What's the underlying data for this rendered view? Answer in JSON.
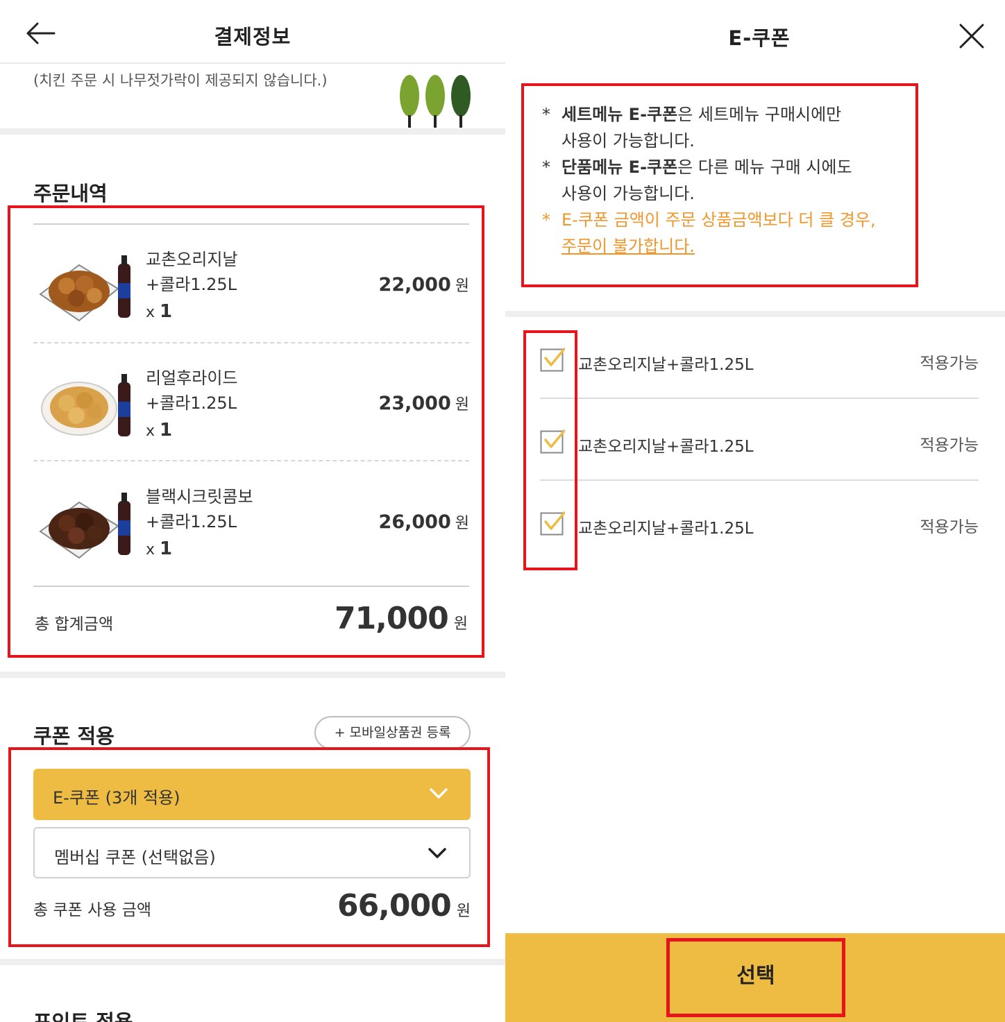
{
  "left_panel": {
    "header_title": "결제정보",
    "notice": "(치킨 주문 시 나무젓가락이 제공되지 않습니다.)",
    "order_section_title": "주문내역",
    "orders": [
      {
        "name_line1": "교촌오리지날",
        "name_line2": "+콜라1.25L",
        "qty_prefix": "x",
        "qty": "1",
        "price": "22,000",
        "currency": "원"
      },
      {
        "name_line1": "리얼후라이드",
        "name_line2": "+콜라1.25L",
        "qty_prefix": "x",
        "qty": "1",
        "price": "23,000",
        "currency": "원"
      },
      {
        "name_line1": "블랙시크릿콤보",
        "name_line2": "+콜라1.25L",
        "qty_prefix": "x",
        "qty": "1",
        "price": "26,000",
        "currency": "원"
      }
    ],
    "order_total_label": "총 합계금액",
    "order_total_amount": "71,000",
    "order_total_currency": "원",
    "coupon_section_title": "쿠폰 적용",
    "mobile_voucher_button": "+ 모바일상품권 등록",
    "ecoupon_select": "E-쿠폰 (3개 적용)",
    "membership_select": "멤버십 쿠폰 (선택없음)",
    "coupon_total_label": "총 쿠폰 사용 금액",
    "coupon_total_amount": "66,000",
    "coupon_total_currency": "원",
    "point_section_title": "포인트 적용"
  },
  "right_panel": {
    "header_title": "E-쿠폰",
    "notes": [
      {
        "bold": "세트메뉴 E-쿠폰",
        "rest": "은 세트메뉴 구매시에만",
        "line2": "사용이 가능합니다."
      },
      {
        "bold": "단품메뉴 E-쿠폰",
        "rest": "은 다른 메뉴 구매 시에도",
        "line2": "사용이 가능합니다."
      }
    ],
    "warning_line1": "E-쿠폰 금액이 주문 상품금액보다 더 클 경우,",
    "warning_line2": "주문이 불가합니다.",
    "star": "*",
    "coupons": [
      {
        "name": "교촌오리지날+콜라1.25L",
        "status": "적용가능",
        "checked": true
      },
      {
        "name": "교촌오리지날+콜라1.25L",
        "status": "적용가능",
        "checked": true
      },
      {
        "name": "교촌오리지날+콜라1.25L",
        "status": "적용가능",
        "checked": true
      }
    ],
    "select_button": "선택"
  },
  "colors": {
    "accent_yellow": "#eebc42",
    "highlight_red": "#e8141c",
    "warning_orange": "#f0962a",
    "tree_light": "#7aa42f",
    "tree_dark": "#2f5a23"
  },
  "icons": [
    "back-arrow-icon",
    "trees-logo-icon",
    "chevron-down-icon",
    "close-icon",
    "checkbox-checked-icon"
  ]
}
